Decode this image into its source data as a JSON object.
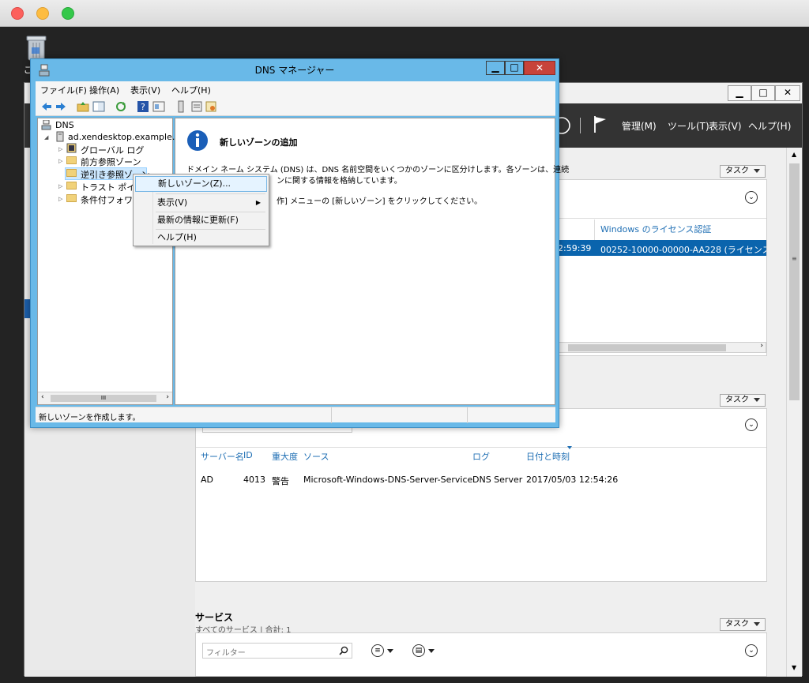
{
  "desktop": {
    "trash_label": "ご"
  },
  "server_manager": {
    "menu": [
      "管理(M)",
      "ツール(T)",
      "表示(V)",
      "ヘルプ(H)"
    ],
    "win_controls": [
      "▁",
      "□",
      "✕"
    ],
    "tasks_label": "タスク",
    "license_tile": {
      "column_header": "Windows のライセンス認証",
      "row_time": "2:59:39",
      "row_value": "00252-10000-00000-AA228 (ライセンス認証"
    },
    "events_tile": {
      "columns": [
        "サーバー名",
        "ID",
        "重大度",
        "ソース",
        "ログ",
        "日付と時刻"
      ],
      "rows": [
        [
          "AD",
          "4013",
          "警告",
          "Microsoft-Windows-DNS-Server-Service",
          "DNS Server",
          "2017/05/03 12:54:26"
        ]
      ]
    },
    "services": {
      "title": "サービス",
      "subtitle": "すべてのサービス | 合計: 1",
      "filter_placeholder": "フィルター"
    }
  },
  "dns_manager": {
    "title": "DNS マネージャー",
    "controls": [
      "▁",
      "□",
      "✕"
    ],
    "menu": [
      "ファイル(F)",
      "操作(A)",
      "表示(V)",
      "ヘルプ(H)"
    ],
    "tree": {
      "root": "DNS",
      "server": "ad.xendesktop.example.c",
      "items": [
        "グローバル ログ",
        "前方参照ゾーン",
        "逆引き参照ゾーン",
        "トラスト ポイント",
        "条件付フォワーダ"
      ]
    },
    "right_pane": {
      "heading": "新しいゾーンの追加",
      "line1": "ドメイン ネーム システム (DNS) は、DNS 名前空間をいくつかのゾーンに区分けします。各ゾーンは、連続",
      "line2": "ンに関する情報を格納しています。",
      "line3": "作] メニューの [新しいゾーン] をクリックしてください。"
    },
    "status_text": "新しいゾーンを作成します。",
    "scroll_mark": "III"
  },
  "context_menu": {
    "items": [
      "新しいゾーン(Z)...",
      "表示(V)",
      "最新の情報に更新(F)",
      "ヘルプ(H)"
    ]
  },
  "colors": {
    "title_blue": "#69b9e8",
    "selection_blue": "#0a64ad",
    "close_red": "#c7433a"
  }
}
